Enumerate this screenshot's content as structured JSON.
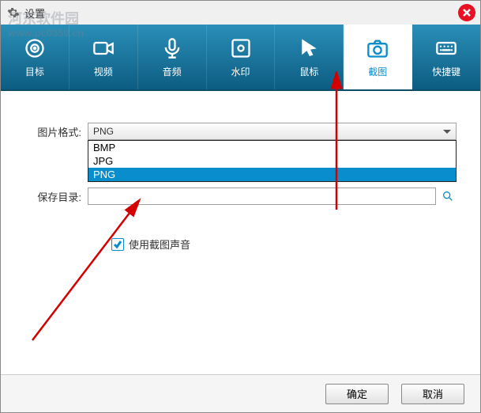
{
  "titlebar": {
    "title": "设置"
  },
  "watermark": {
    "text": "河东软件园",
    "url": "www.pc0359.cn"
  },
  "tabs": [
    {
      "label": "目标",
      "icon": "target"
    },
    {
      "label": "视频",
      "icon": "video"
    },
    {
      "label": "音频",
      "icon": "mic"
    },
    {
      "label": "水印",
      "icon": "watermark"
    },
    {
      "label": "鼠标",
      "icon": "cursor"
    },
    {
      "label": "截图",
      "icon": "camera",
      "active": true
    },
    {
      "label": "快捷键",
      "icon": "keyboard"
    }
  ],
  "form": {
    "imageFormat": {
      "label": "图片格式:",
      "value": "PNG"
    },
    "saveDir": {
      "label": "保存目录:",
      "value": ""
    },
    "useSound": {
      "label": "使用截图声音",
      "checked": true
    }
  },
  "dropdown": {
    "options": [
      "BMP",
      "JPG",
      "PNG"
    ],
    "selected": "PNG"
  },
  "footer": {
    "ok": "确定",
    "cancel": "取消"
  }
}
